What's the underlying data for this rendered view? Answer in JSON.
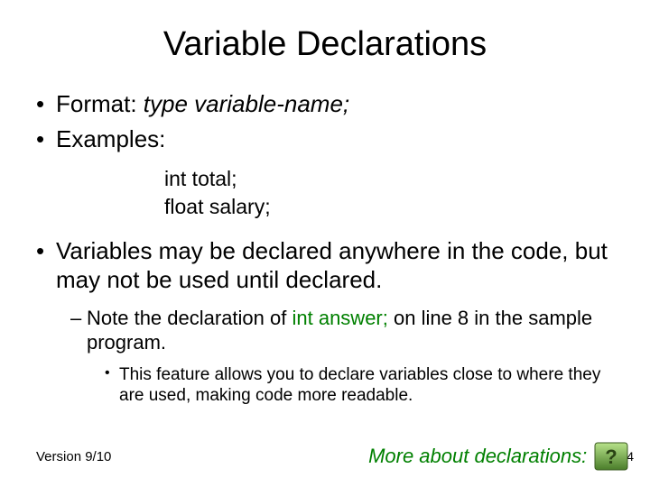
{
  "title": "Variable Declarations",
  "bullets": {
    "b1_label": "Format:  ",
    "b1_italic": "type variable-name;",
    "b2": "Examples:",
    "code1": "int total;",
    "code2": "float salary;",
    "b3": "Variables may be declared anywhere in the code, but may not be used until declared.",
    "sub_pre": "Note the declaration of ",
    "sub_code": "int answer;",
    "sub_post": " on line 8 in the sample program.",
    "subsub": "This feature allows you to declare variables close to where they are used, making code more readable."
  },
  "footer": {
    "version": "Version 9/10",
    "more": "More about declarations:",
    "pagenum": "4"
  },
  "icons": {
    "question": "question-mark-icon"
  }
}
